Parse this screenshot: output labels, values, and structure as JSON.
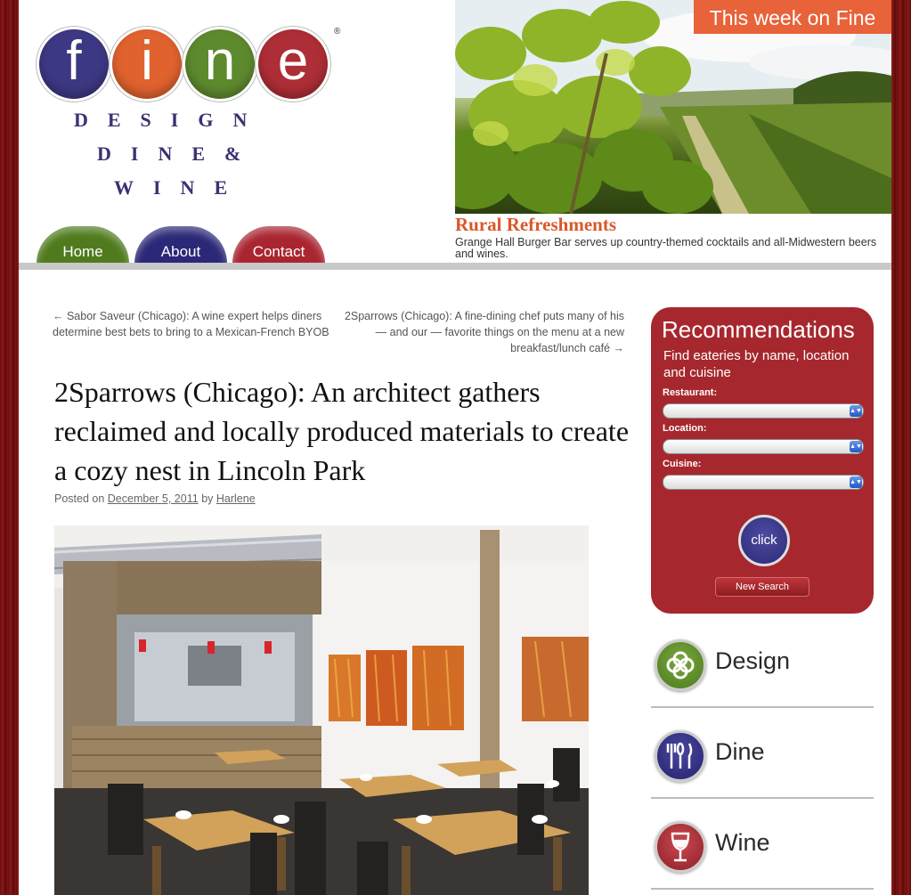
{
  "logo": {
    "letters": [
      "f",
      "i",
      "n",
      "e"
    ],
    "registered": "®",
    "tagline_1": "DESIGN",
    "tagline_2": "DINE&",
    "tagline_3": "WINE",
    "colors": [
      "#3d3883",
      "#e0622e",
      "#5e8a2e",
      "#ad2e36"
    ]
  },
  "nav": {
    "items": [
      {
        "label": "Home",
        "color": "#4f7b1e"
      },
      {
        "label": "About",
        "color": "#2b2877"
      },
      {
        "label": "Contact",
        "color": "#a92631"
      }
    ]
  },
  "featured": {
    "badge": "This week on Fine",
    "title": "Rural Refreshments",
    "text": "Grange Hall Burger Bar serves up country-themed cocktails and all-Midwestern beers and wines."
  },
  "post_nav": {
    "prev": "← Sabor Saveur (Chicago): A wine expert helps diners determine best bets to bring to a Mexican-French BYOB",
    "next": "2Sparrows (Chicago): A fine-dining chef puts many of his — and our — favorite things on the menu at a new breakfast/lunch café →"
  },
  "post": {
    "title": "2Sparrows (Chicago): An architect gathers reclaimed and locally produced materials to create a cozy nest in Lincoln Park",
    "posted_on": "Posted on",
    "date": "December 5, 2011",
    "by": "by",
    "author": "Harlene"
  },
  "recommendations": {
    "title": "Recommendations",
    "subtitle": "Find eateries by name, location and cuisine",
    "fields": [
      {
        "label": "Restaurant:",
        "value": ""
      },
      {
        "label": "Location:",
        "value": ""
      },
      {
        "label": "Cuisine:",
        "value": ""
      }
    ],
    "click_label": "click",
    "new_search_label": "New Search"
  },
  "categories": [
    {
      "label": "Design",
      "icon": "flower-icon",
      "color": "#5a8a2c"
    },
    {
      "label": "Dine",
      "icon": "utensils-icon",
      "color": "#2e2a7a"
    },
    {
      "label": "Wine",
      "icon": "wine-glass-icon",
      "color": "#b2303a"
    }
  ]
}
